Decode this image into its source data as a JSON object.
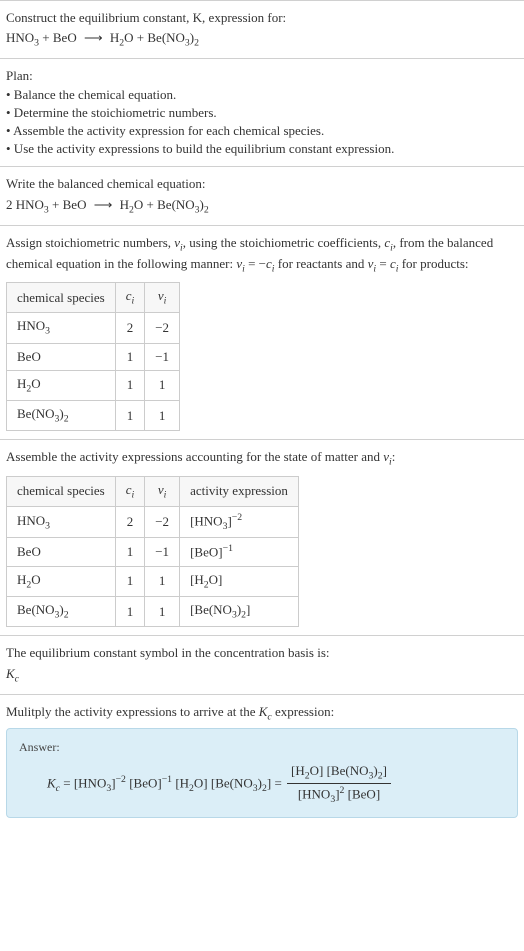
{
  "prompt": {
    "line1": "Construct the equilibrium constant, K, expression for:",
    "equation_lhs1": "HNO",
    "equation_lhs1_sub": "3",
    "equation_plus": " + ",
    "equation_lhs2": "BeO",
    "equation_arrow": "⟶",
    "equation_rhs1": "H",
    "equation_rhs1_sub": "2",
    "equation_rhs1b": "O",
    "equation_rhs2": "Be(NO",
    "equation_rhs2_sub": "3",
    "equation_rhs2b": ")",
    "equation_rhs2_sub2": "2"
  },
  "plan": {
    "heading": "Plan:",
    "b1": "• Balance the chemical equation.",
    "b2": "• Determine the stoichiometric numbers.",
    "b3": "• Assemble the activity expression for each chemical species.",
    "b4": "• Use the activity expressions to build the equilibrium constant expression."
  },
  "balanced": {
    "heading": "Write the balanced chemical equation:",
    "coef1": "2 ",
    "lhs1": "HNO",
    "lhs1_sub": "3",
    "plus": " + ",
    "lhs2": "BeO",
    "arrow": "⟶",
    "rhs1": "H",
    "rhs1_sub": "2",
    "rhs1b": "O",
    "rhs2": "Be(NO",
    "rhs2_sub": "3",
    "rhs2b": ")",
    "rhs2_sub2": "2"
  },
  "stoich": {
    "text_a": "Assign stoichiometric numbers, ",
    "nu": "ν",
    "sub_i": "i",
    "text_b": ", using the stoichiometric coefficients, ",
    "c": "c",
    "text_c": ", from the balanced chemical equation in the following manner: ",
    "rel1a": " = −",
    "text_d": " for reactants and ",
    "rel2a": " = ",
    "text_e": " for products:",
    "headers": {
      "species": "chemical species",
      "ci": "c",
      "nui": "ν"
    },
    "rows": [
      {
        "sp_a": "HNO",
        "sp_sub": "3",
        "sp_b": "",
        "sp_sub2": "",
        "ci": "2",
        "nui": "−2"
      },
      {
        "sp_a": "BeO",
        "sp_sub": "",
        "sp_b": "",
        "sp_sub2": "",
        "ci": "1",
        "nui": "−1"
      },
      {
        "sp_a": "H",
        "sp_sub": "2",
        "sp_b": "O",
        "sp_sub2": "",
        "ci": "1",
        "nui": "1"
      },
      {
        "sp_a": "Be(NO",
        "sp_sub": "3",
        "sp_b": ")",
        "sp_sub2": "2",
        "ci": "1",
        "nui": "1"
      }
    ]
  },
  "activity": {
    "heading_a": "Assemble the activity expressions accounting for the state of matter and ",
    "heading_b": ":",
    "headers": {
      "species": "chemical species",
      "ci": "c",
      "nui": "ν",
      "act": "activity expression"
    },
    "rows": [
      {
        "sp_a": "HNO",
        "sp_sub": "3",
        "sp_b": "",
        "sp_sub2": "",
        "ci": "2",
        "nui": "−2",
        "act_open": "[HNO",
        "act_sub": "3",
        "act_close": "]",
        "act_sup": "−2"
      },
      {
        "sp_a": "BeO",
        "sp_sub": "",
        "sp_b": "",
        "sp_sub2": "",
        "ci": "1",
        "nui": "−1",
        "act_open": "[BeO",
        "act_sub": "",
        "act_close": "]",
        "act_sup": "−1"
      },
      {
        "sp_a": "H",
        "sp_sub": "2",
        "sp_b": "O",
        "sp_sub2": "",
        "ci": "1",
        "nui": "1",
        "act_open": "[H",
        "act_sub": "2",
        "act_close": "O]",
        "act_sup": ""
      },
      {
        "sp_a": "Be(NO",
        "sp_sub": "3",
        "sp_b": ")",
        "sp_sub2": "2",
        "ci": "1",
        "nui": "1",
        "act_open": "[Be(NO",
        "act_sub": "3",
        "act_close": ")",
        "act_sup": "",
        "act_sub2": "2",
        "act_close2": "]"
      }
    ]
  },
  "symbol": {
    "line": "The equilibrium constant symbol in the concentration basis is:",
    "kc_k": "K",
    "kc_sub": "c"
  },
  "multiply": {
    "line": "Mulitply the activity expressions to arrive at the ",
    "kc_k": "K",
    "kc_sub": "c",
    "line_b": " expression:"
  },
  "answer": {
    "label": "Answer:",
    "kc_k": "K",
    "kc_sub": "c",
    "eq": " = ",
    "t1": "[HNO",
    "t1_sub": "3",
    "t1_close": "]",
    "t1_sup": "−2",
    "sp": " ",
    "t2": "[BeO]",
    "t2_sup": "−1",
    "t3": "[H",
    "t3_sub": "2",
    "t3_close": "O]",
    "t4": "[Be(NO",
    "t4_sub": "3",
    "t4_close": ")",
    "t4_sub2": "2",
    "t4_close2": "]",
    "eq2": " = ",
    "num_a": "[H",
    "num_a_sub": "2",
    "num_a_close": "O] [Be(NO",
    "num_b_sub": "3",
    "num_b_close": ")",
    "num_c_sub": "2",
    "num_c_close": "]",
    "den_a": "[HNO",
    "den_a_sub": "3",
    "den_a_close": "]",
    "den_a_sup": "2",
    "den_b": " [BeO]"
  }
}
